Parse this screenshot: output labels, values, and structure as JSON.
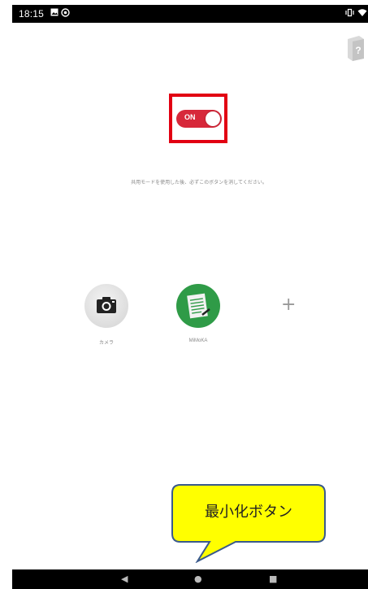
{
  "status_bar": {
    "time": "18:15",
    "left_icons": [
      "image-icon",
      "at-icon"
    ],
    "right_icons": [
      "vibrate-icon",
      "wifi-icon"
    ]
  },
  "top": {
    "help_icon": "help-book-icon"
  },
  "toggle": {
    "state_label": "ON",
    "accent_color": "#d7283a",
    "highlight_color": "#e20012"
  },
  "instruction": {
    "text": "共用モードを使用した後、必ずこのボタンを消してください。"
  },
  "apps": [
    {
      "label": "カメラ",
      "icon": "camera-icon"
    },
    {
      "label": "MiMoKA",
      "icon": "notebook-icon"
    }
  ],
  "add_app": {
    "label": "+"
  },
  "callout": {
    "text": "最小化ボタン",
    "fill_color": "#ffff00",
    "border_color": "#3a5a8c"
  },
  "nav_bar": {
    "back": "◀",
    "home": "●",
    "recents": "■"
  }
}
